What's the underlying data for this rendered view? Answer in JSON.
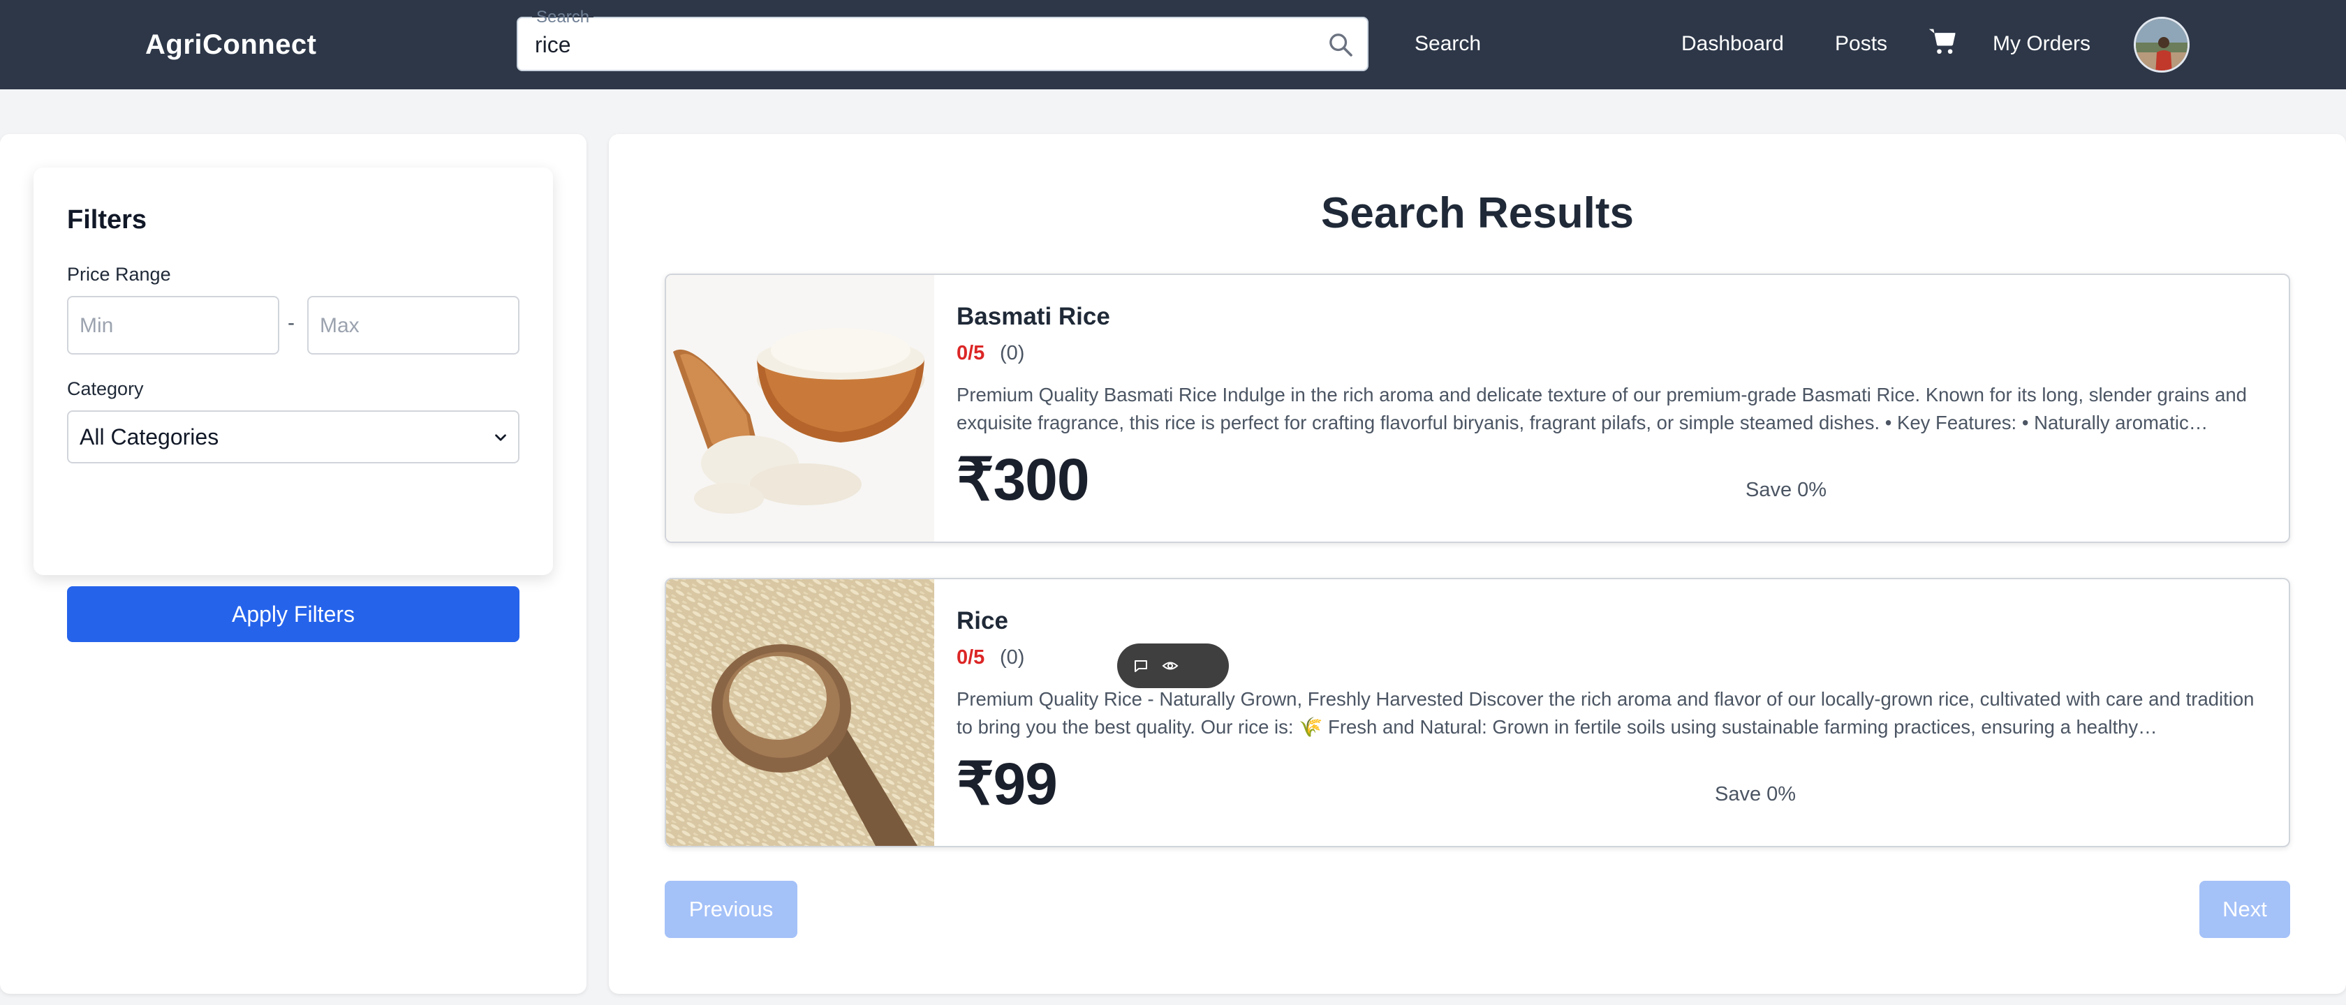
{
  "navbar": {
    "brand": "AgriConnect",
    "search": {
      "legend": "Search",
      "value": "rice"
    },
    "search_button": "Search",
    "links": {
      "dashboard": "Dashboard",
      "posts": "Posts",
      "orders": "My Orders"
    },
    "bg_color": "#2d3748"
  },
  "filters": {
    "title": "Filters",
    "price_label": "Price Range",
    "min_placeholder": "Min",
    "max_placeholder": "Max",
    "dash": "-",
    "category_label": "Category",
    "category_selected": "All Categories",
    "apply_label": "Apply Filters",
    "accent_color": "#2563eb"
  },
  "results": {
    "title": "Search Results",
    "products": [
      {
        "name": "Basmati Rice",
        "rating": "0/5",
        "reviews": "(0)",
        "description": "Premium Quality Basmati Rice Indulge in the rich aroma and delicate texture of our premium-grade Basmati Rice. Known for its long, slender grains and exquisite fragrance, this rice is perfect for crafting flavorful biryanis, fragrant pilafs, or simple steamed dishes. • Key Features: • Naturally aromatic…",
        "price": "₹300",
        "save": "Save 0%"
      },
      {
        "name": "Rice",
        "rating": "0/5",
        "reviews": "(0)",
        "description": "Premium Quality Rice - Naturally Grown, Freshly Harvested Discover the rich aroma and flavor of our locally-grown rice, cultivated with care and tradition to bring you the best quality. Our rice is: 🌾 Fresh and Natural: Grown in fertile soils using sustainable farming practices, ensuring a healthy…",
        "price": "₹99",
        "save": "Save 0%"
      }
    ],
    "pagination": {
      "previous": "Previous",
      "next": "Next"
    }
  },
  "icons": {
    "search": "search-icon",
    "cart": "cart-icon",
    "chevron": "chevron-down-icon",
    "comment": "comment-icon",
    "eye": "eye-icon"
  }
}
